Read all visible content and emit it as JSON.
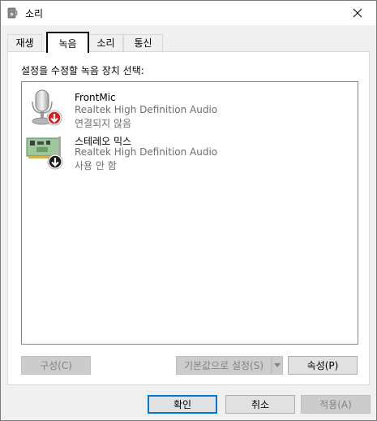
{
  "window": {
    "title": "소리",
    "icon": "speaker-icon"
  },
  "tabs": [
    {
      "label": "재생",
      "active": false
    },
    {
      "label": "녹음",
      "active": true
    },
    {
      "label": "소리",
      "active": false
    },
    {
      "label": "통신",
      "active": false
    }
  ],
  "panel": {
    "instruction": "설정을 수정할 녹음 장치 선택:",
    "devices": [
      {
        "name": "FrontMic",
        "description": "Realtek High Definition Audio",
        "status": "연결되지 않음",
        "icon": "microphone-icon",
        "badge": "red-down-arrow-icon"
      },
      {
        "name": "스테레오 믹스",
        "description": "Realtek High Definition Audio",
        "status": "사용 안 함",
        "icon": "sound-card-icon",
        "badge": "black-down-arrow-icon"
      }
    ],
    "buttons": {
      "configure": "구성(C)",
      "set_default": "기본값으로 설정(S)",
      "properties": "속성(P)"
    }
  },
  "footer": {
    "ok": "확인",
    "cancel": "취소",
    "apply": "적용(A)"
  },
  "colors": {
    "accent": "#0078d7",
    "disabled_text": "#838383",
    "secondary_text": "#6d6d6d",
    "badge_red": "#d21f1f"
  }
}
